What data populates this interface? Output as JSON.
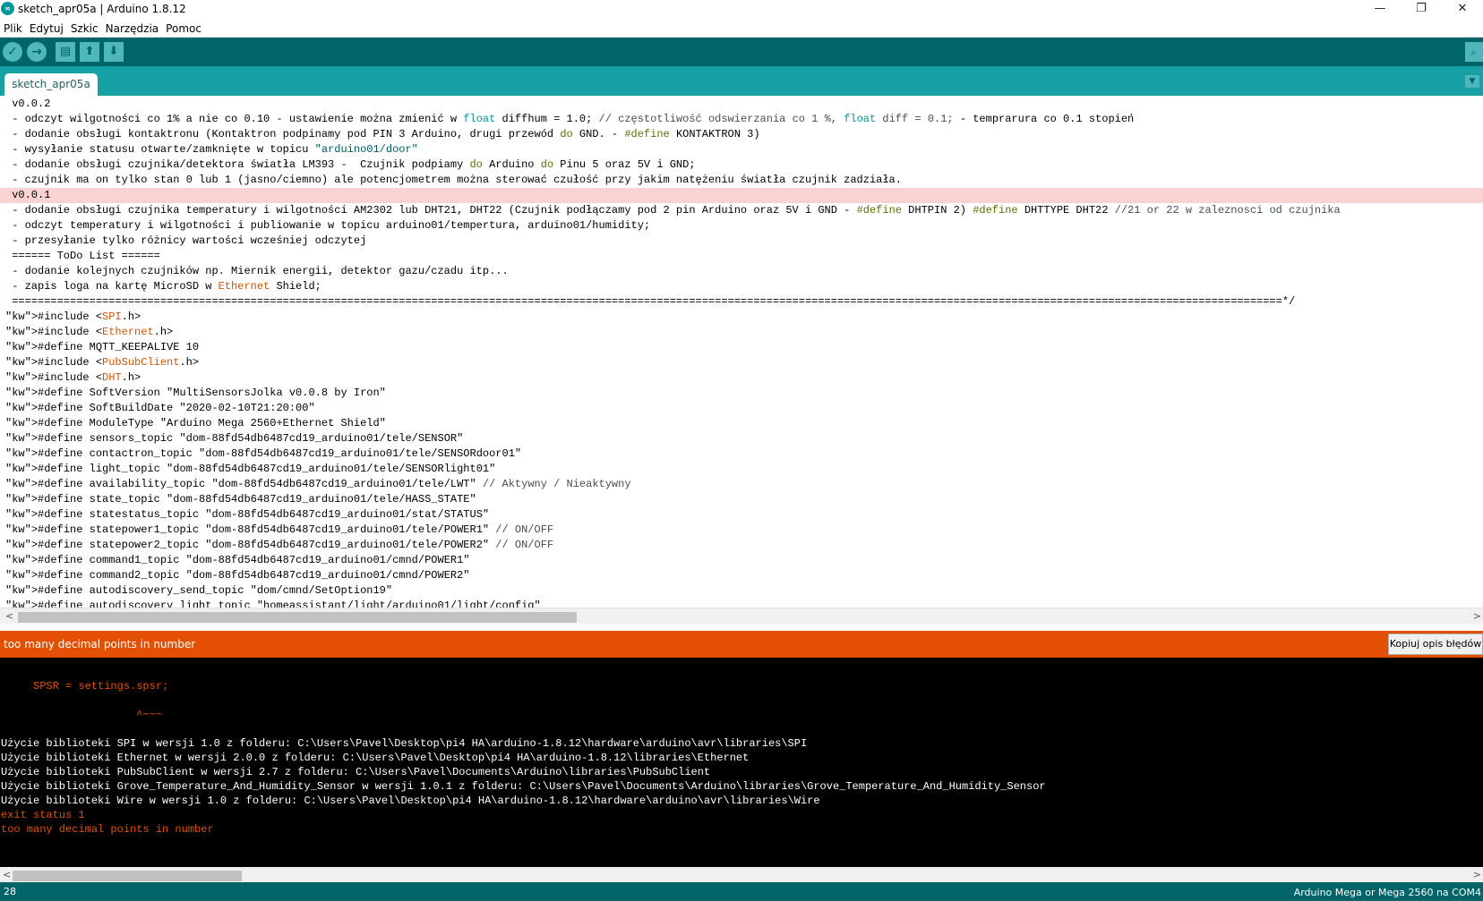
{
  "window": {
    "title": "sketch_apr05a | Arduino 1.8.12",
    "logo": "∞",
    "minimize": "—",
    "restore": "❐",
    "close": "✕"
  },
  "menu": [
    "Plik",
    "Edytuj",
    "Szkic",
    "Narzędzia",
    "Pomoc"
  ],
  "toolbar": {
    "verify_icon": "✓",
    "upload_icon": "→",
    "new_icon": "▤",
    "open_icon": "⬆",
    "save_icon": "⬇",
    "serial_monitor_icon": "⌕"
  },
  "tabs": {
    "active": "sketch_apr05a",
    "menu_icon": "▼"
  },
  "editor": {
    "highlight_line": 6,
    "lines": [
      " v0.0.2",
      " - odczyt wilgotności co 1% a nie co 0.10 - ustawienie można zmienić w float diffhum = 1.0; // częstotliwość odswierzania co 1 %, float diff = 0.1; - temprarura co 0.1 stopień",
      " - dodanie obsługi kontaktronu (Kontaktron podpinamy pod PIN 3 Arduino, drugi przewód do GND. - #define KONTAKTRON 3)",
      " - wysyłanie statusu otwarte/zamknięte w topicu \"arduino01/door\"",
      " - dodanie obsługi czujnika/detektora światła LM393 -  Czujnik podpiamy do Arduino do Pinu 5 oraz 5V i GND;",
      " - czujnik ma on tylko stan 0 lub 1 (jasno/ciemno) ale potencjometrem można sterować czułość przy jakim natężeniu światła czujnik zadziała.",
      " v0.0.1",
      " - dodanie obsługi czujnika temperatury i wilgotności AM2302 lub DHT21, DHT22 (Czujnik podłączamy pod 2 pin Arduino oraz 5V i GND - #define DHTPIN 2) #define DHTTYPE DHT22 //21 or 22 w zaleznosci od czujnika",
      " - odczyt temperatury i wilgotności i publiowanie w topicu arduino01/tempertura, arduino01/humidity;",
      " - przesyłanie tylko różnicy wartości wcześniej odczytej",
      " ====== ToDo List ======",
      " - dodanie kolejnych czujników np. Miernik energii, detektor gazu/czadu itp...",
      " - zapis loga na kartę MicroSD w Ethernet Shield;",
      " =====================================================================================================================================================================================================*/",
      "#include <SPI.h>",
      "#include <Ethernet.h>",
      "#define MQTT_KEEPALIVE 10",
      "#include <PubSubClient.h>",
      "#include <DHT.h>",
      "#define SoftVersion \"MultiSensorsJolka v0.0.8 by Iron\"",
      "#define SoftBuildDate \"2020-02-10T21:20:00\"",
      "#define ModuleType \"Arduino Mega 2560+Ethernet Shield\"",
      "#define sensors_topic \"dom-88fd54db6487cd19_arduino01/tele/SENSOR\"",
      "#define contactron_topic \"dom-88fd54db6487cd19_arduino01/tele/SENSORdoor01\"",
      "#define light_topic \"dom-88fd54db6487cd19_arduino01/tele/SENSORlight01\"",
      "#define availability_topic \"dom-88fd54db6487cd19_arduino01/tele/LWT\" // Aktywny / Nieaktywny",
      "#define state_topic \"dom-88fd54db6487cd19_arduino01/tele/HASS_STATE\"",
      "#define statestatus_topic \"dom-88fd54db6487cd19_arduino01/stat/STATUS\"",
      "#define statepower1_topic \"dom-88fd54db6487cd19_arduino01/tele/POWER1\" // ON/OFF",
      "#define statepower2_topic \"dom-88fd54db6487cd19_arduino01/tele/POWER2\" // ON/OFF",
      "#define command1_topic \"dom-88fd54db6487cd19_arduino01/cmnd/POWER1\"",
      "#define command2_topic \"dom-88fd54db6487cd19_arduino01/cmnd/POWER2\"",
      "#define autodiscovery_send_topic \"dom/cmnd/SetOption19\"",
      "#define autodiscovery_light_topic \"homeassistant/light/arduino01/light/config\""
    ],
    "scroll_left": "<",
    "scroll_right": ">"
  },
  "error_bar": {
    "message": "too many decimal points in number",
    "copy_button": "Kopiuj opis błędów"
  },
  "console": {
    "lines": [
      {
        "text": "     SPSR = settings.spsr;",
        "color": "orange",
        "row": 1
      },
      {
        "text": "                     ^~~~",
        "color": "orange",
        "row": 3
      },
      {
        "text": "Użycie biblioteki SPI w wersji 1.0 z folderu: C:\\Users\\Pavel\\Desktop\\pi4 HA\\arduino-1.8.12\\hardware\\arduino\\avr\\libraries\\SPI",
        "color": "white",
        "row": 5
      },
      {
        "text": "Użycie biblioteki Ethernet w wersji 2.0.0 z folderu: C:\\Users\\Pavel\\Desktop\\pi4 HA\\arduino-1.8.12\\libraries\\Ethernet",
        "color": "white",
        "row": 6
      },
      {
        "text": "Użycie biblioteki PubSubClient w wersji 2.7 z folderu: C:\\Users\\Pavel\\Documents\\Arduino\\libraries\\PubSubClient",
        "color": "white",
        "row": 7
      },
      {
        "text": "Użycie biblioteki Grove_Temperature_And_Humidity_Sensor w wersji 1.0.1 z folderu: C:\\Users\\Pavel\\Documents\\Arduino\\libraries\\Grove_Temperature_And_Humidity_Sensor",
        "color": "white",
        "row": 8
      },
      {
        "text": "Użycie biblioteki Wire w wersji 1.0 z folderu: C:\\Users\\Pavel\\Desktop\\pi4 HA\\arduino-1.8.12\\hardware\\arduino\\avr\\libraries\\Wire",
        "color": "white",
        "row": 9
      },
      {
        "text": "exit status 1",
        "color": "orange",
        "row": 10
      },
      {
        "text": "too many decimal points in number",
        "color": "orange",
        "row": 11
      }
    ],
    "scroll_left": "<",
    "scroll_right": ">"
  },
  "status": {
    "line_number": "28",
    "board": "Arduino Mega or Mega 2560 na COM4"
  },
  "colors": {
    "teal_dark": "#006468",
    "teal": "#17a1a5",
    "error_orange": "#e35004",
    "highlight": "#f9d2d2"
  }
}
